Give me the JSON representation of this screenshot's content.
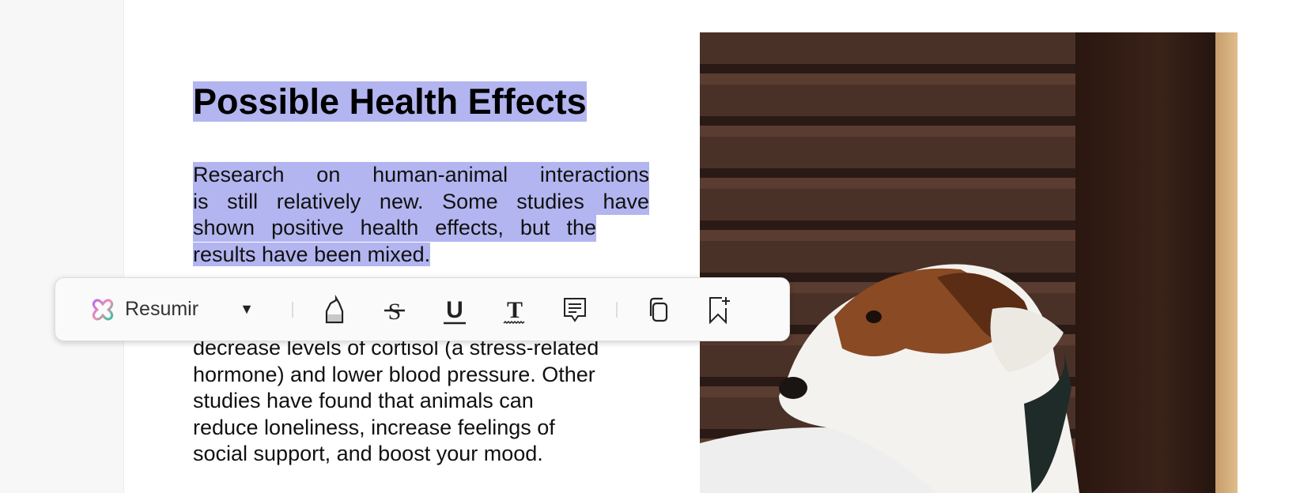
{
  "document": {
    "title": "Possible Health Effects",
    "paragraph1_lines": [
      "Research on human-animal interactions",
      "is still relatively new. Some studies have",
      "shown positive health effects, but the",
      "results have been mixed."
    ],
    "paragraph2_lines": [
      "decrease levels of cortisol (a stress-related",
      "hormone) and lower blood pressure. Other",
      "studies have found that animals can",
      "reduce loneliness, increase feelings of",
      "social support, and boost your mood."
    ],
    "selection_color": "#b3b5f0"
  },
  "toolbar": {
    "ai_label": "Resumir",
    "ai_icon": "ai-assistant-icon",
    "tools": [
      "highlight-icon",
      "strikethrough-icon",
      "underline-icon",
      "squiggly-text-icon",
      "comment-icon",
      "copy-icon",
      "bookmark-add-icon"
    ]
  }
}
